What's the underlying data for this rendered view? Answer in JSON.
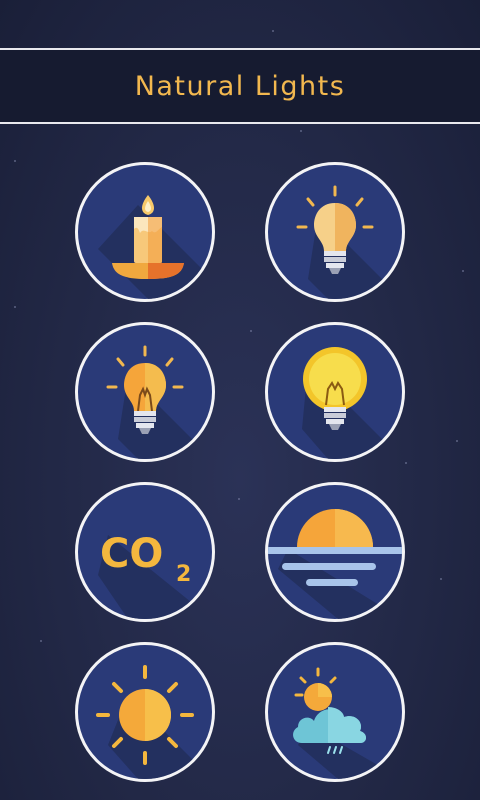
{
  "header": {
    "title": "Natural Lights"
  },
  "tiles": [
    {
      "icon": "candle-icon"
    },
    {
      "icon": "lightbulb-icon"
    },
    {
      "icon": "lightbulb-icon"
    },
    {
      "icon": "glowing-lightbulb-icon"
    },
    {
      "icon": "co2-icon",
      "text": "CO",
      "subscript": "2"
    },
    {
      "icon": "sunset-over-water-icon"
    },
    {
      "icon": "sun-icon"
    },
    {
      "icon": "sun-behind-cloud-rain-icon"
    }
  ],
  "colors": {
    "accent": "#f2b84f",
    "tile_bg": "#2a3a78",
    "page_bg": "#222846"
  }
}
